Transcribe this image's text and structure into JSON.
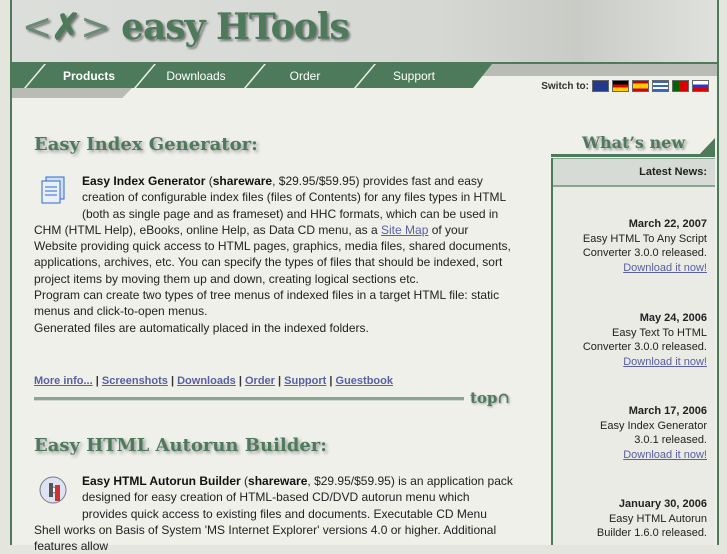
{
  "header": {
    "logo_text": "easy HTools",
    "logo_brackets_left": "<",
    "logo_brackets_right": ">",
    "logo_glyph": "✗"
  },
  "nav": {
    "tabs": [
      {
        "label": "Products",
        "active": true
      },
      {
        "label": "Downloads"
      },
      {
        "label": "Order"
      },
      {
        "label": "Support"
      }
    ],
    "switch_label": "Switch to:",
    "flags": [
      "en",
      "de",
      "es",
      "gr",
      "pt",
      "ru"
    ]
  },
  "section1": {
    "title": "Easy Index Generator:",
    "name": "Easy Index Generator",
    "license": "shareware",
    "price": ", $29.95/$59.95) provides fast and easy creation of configurable index files (files of Contents) for any files types in HTML (both as single page and as frameset) and HHC formats, which can be used in CHM (HTML Help), eBooks, online Help, as Data CD menu, as a ",
    "sitemap_link": "Site Map",
    "text_after": " of your Website providing quick access to HTML pages, graphics, media files, shared documents, applications, archives, etc. You can specify the types of files that should be indexed, sort project items by moving them up and down, creating logical sections etc.",
    "para2": "Program can create two types of tree menus of indexed files in a target HTML file: static menus and click-to-open menus.",
    "para3": "Generated files are automatically placed in the indexed folders.",
    "links": [
      "More info...",
      "Screenshots",
      "Downloads",
      "Order",
      "Support",
      "Guestbook"
    ],
    "top_label": "top"
  },
  "section2": {
    "title": "Easy HTML Autorun Builder:",
    "name": "Easy HTML Autorun Builder",
    "license": "shareware",
    "text": ", $29.95/$59.95) is an application pack designed for easy creation of HTML-based CD/DVD autorun menu which provides quick access to existing files and documents. Executable CD Menu Shell works on Basis of System 'MS Internet Explorer' versions 4.0 or higher. Additional features allow"
  },
  "sidebar": {
    "title": "What’s new",
    "latest_label": "Latest News:",
    "news": [
      {
        "date": "March 22, 2007",
        "text": "Easy HTML To Any Script Converter 3.0.0 released.",
        "link": "Download it now!"
      },
      {
        "date": "May 24, 2006",
        "text": "Easy Text To HTML Converter 3.0.0 released.",
        "link": "Download it now!"
      },
      {
        "date": "March 17, 2006",
        "text": "Easy Index Generator 3.0.1 released.",
        "link": "Download it now!"
      },
      {
        "date": "January 30, 2006",
        "text": "Easy HTML Autorun Builder 1.6.0 released."
      }
    ]
  },
  "colors": {
    "brand": "#4e7a5c",
    "link": "#5a5fa0"
  }
}
